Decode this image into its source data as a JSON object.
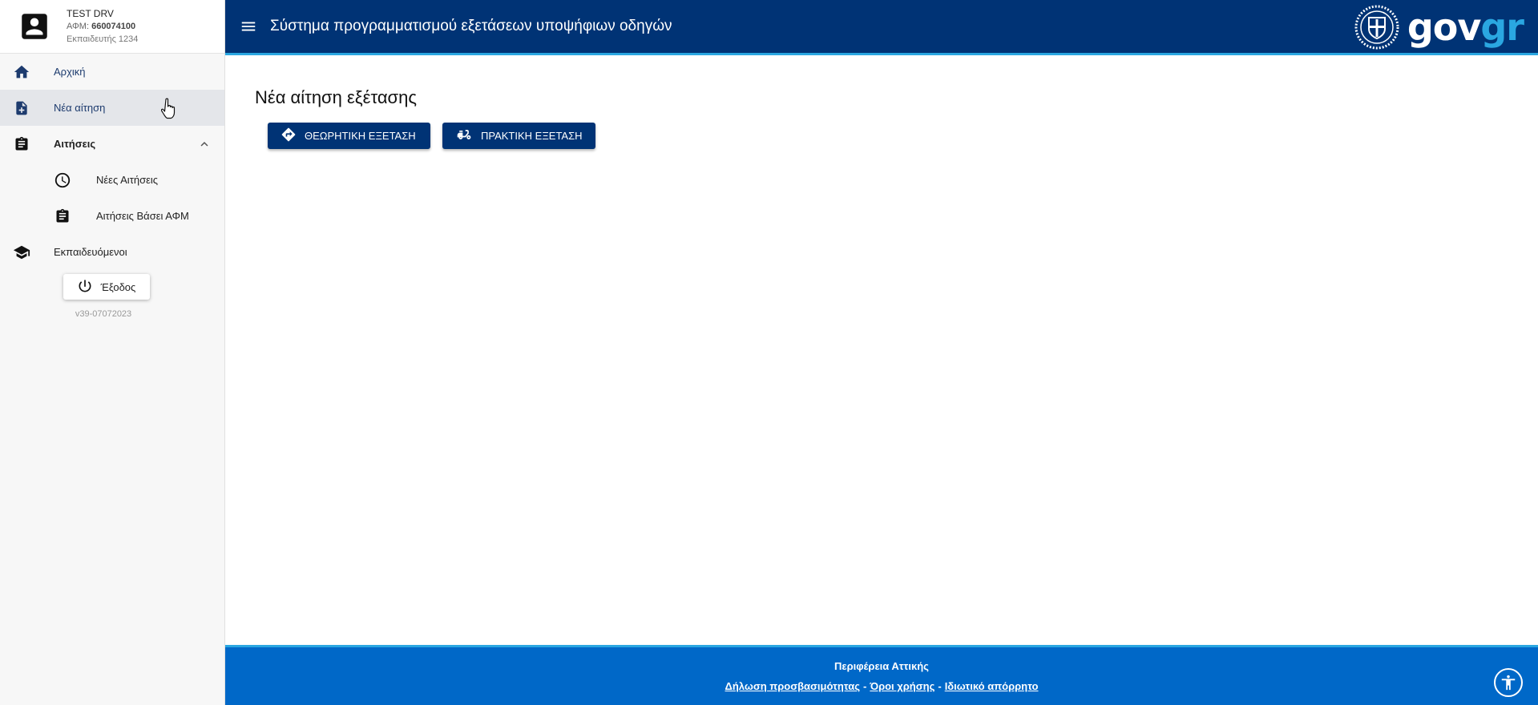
{
  "user": {
    "name": "TEST DRV",
    "afm_label": "ΑΦΜ:",
    "afm_value": "660074100",
    "role": "Εκπαιδευτής 1234"
  },
  "sidebar": {
    "items": [
      {
        "label": "Αρχική",
        "icon": "home-icon"
      },
      {
        "label": "Νέα αίτηση",
        "icon": "note-add-icon"
      },
      {
        "label": "Αιτήσεις",
        "icon": "clipboard-icon"
      },
      {
        "label": "Νέες Αιτήσεις",
        "icon": "clock-icon"
      },
      {
        "label": "Αιτήσεις Βάσει ΑΦΜ",
        "icon": "clipboard-icon"
      },
      {
        "label": "Εκπαιδευόμενοι",
        "icon": "school-icon"
      }
    ],
    "logout_label": "Έξοδος",
    "version": "v39-07072023"
  },
  "header": {
    "title": "Σύστημα προγραμματισμού εξετάσεων υποψήφιων οδηγών",
    "logo_gov": "gov",
    "logo_gr": "gr"
  },
  "main": {
    "page_title": "Νέα αίτηση εξέτασης",
    "theory_button": "ΘΕΩΡΗΤΙΚΗ ΕΞΕΤΑΣΗ",
    "practical_button": "ΠΡΑΚΤΙΚΗ ΕΞΕΤΑΣΗ"
  },
  "footer": {
    "region": "Περιφέρεια Αττικής",
    "links": [
      "Δήλωση προσβασιμότητας",
      "Όροι χρήσης",
      "Ιδιωτικό απόρρητο"
    ],
    "separator": "-"
  },
  "colors": {
    "header_bg": "#003375",
    "accent": "#2aa7e1",
    "footer_bg": "#0068c8",
    "sidebar_bg": "#f7f7f7",
    "active_item_bg": "#e4e6ea"
  }
}
